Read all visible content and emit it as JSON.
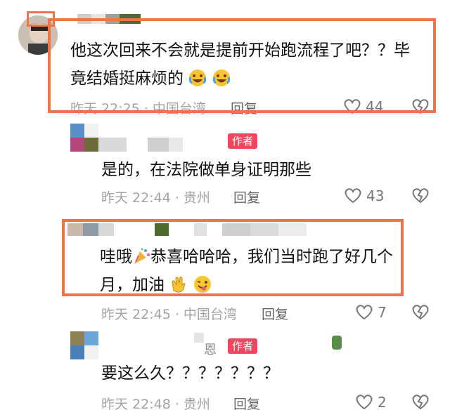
{
  "comments": [
    {
      "text_line1": "他这次回来不会就是提前开始跑流程了吧？？毕",
      "text_line2": "竟结婚挺麻烦的",
      "time": "昨天 22:25 · 中国台湾",
      "reply": "回复",
      "likes": "44"
    },
    {
      "author_tag": "作者",
      "text": "是的，在法院做单身证明那些",
      "time": "昨天 22:44 · 贵州",
      "reply": "回复",
      "likes": "43"
    },
    {
      "text_line1a": "哇哦",
      "text_line1b": "恭喜哈哈哈，我们当时跑了好几个",
      "text_line2": "月，加油",
      "time": "昨天 22:45 · 中国台湾",
      "reply": "回复",
      "likes": "7"
    },
    {
      "name_fragment": "恩",
      "author_tag": "作者",
      "text": "要这么久？？？？？？？",
      "time": "昨天 22:48 · 贵州",
      "reply": "回复",
      "likes": "2"
    }
  ],
  "colors": {
    "highlight_frame": "#ef7448",
    "author_tag": "#f0475e",
    "meta_text": "#a3a3a3"
  }
}
